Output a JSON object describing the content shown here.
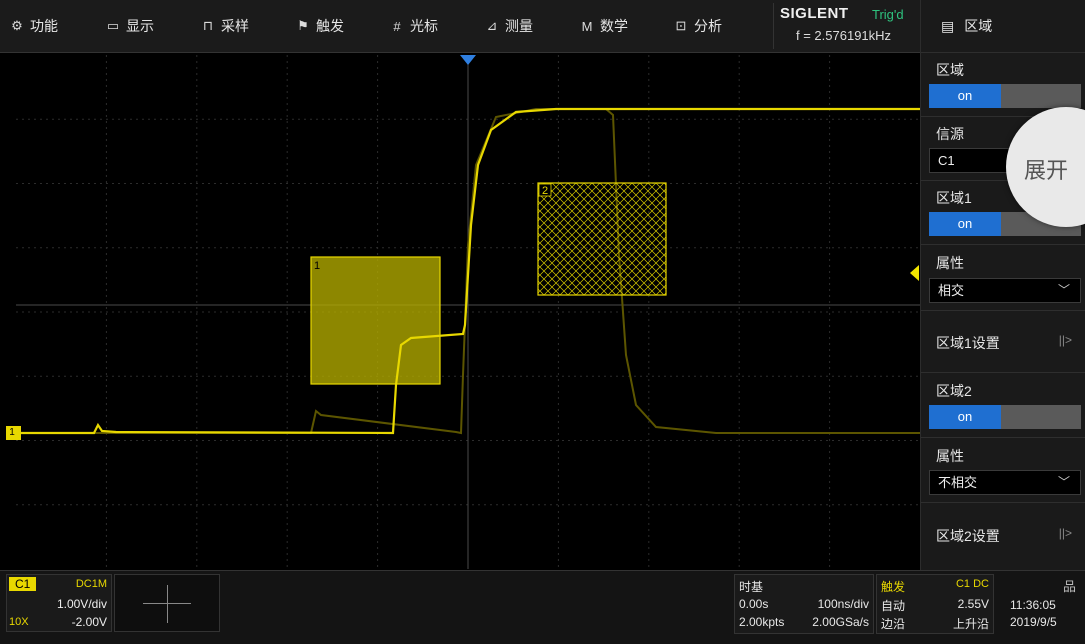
{
  "menu": {
    "items": [
      {
        "label": "功能",
        "icon": "gear-icon",
        "glyph": "⚙"
      },
      {
        "label": "显示",
        "icon": "monitor-icon",
        "glyph": "▭"
      },
      {
        "label": "采样",
        "icon": "acquire-icon",
        "glyph": "⊓"
      },
      {
        "label": "触发",
        "icon": "flag-icon",
        "glyph": "⚑"
      },
      {
        "label": "光标",
        "icon": "cursor-grid-icon",
        "glyph": "#"
      },
      {
        "label": "测量",
        "icon": "measure-icon",
        "glyph": "⊿"
      },
      {
        "label": "数学",
        "icon": "math-icon",
        "glyph": "M"
      },
      {
        "label": "分析",
        "icon": "analysis-icon",
        "glyph": "⊡"
      }
    ]
  },
  "brand": {
    "name": "SIGLENT",
    "status": "Trig'd",
    "frequency": "f = 2.576191kHz"
  },
  "panel": {
    "header": "区域",
    "zone_label": "区域",
    "zone_state": "on",
    "source_label": "信源",
    "source_value": "C1",
    "zone1_label": "区域1",
    "zone1_state": "on",
    "zone1_prop_label": "属性",
    "zone1_prop_value": "相交",
    "zone1_settings": "区域1设置",
    "zone2_label": "区域2",
    "zone2_state": "on",
    "zone2_prop_label": "属性",
    "zone2_prop_value": "不相交",
    "zone2_settings": "区域2设置",
    "expand": "展开",
    "arrow_glyph": "||>"
  },
  "zones": [
    {
      "index": "1"
    },
    {
      "index": "2"
    }
  ],
  "channel": {
    "name": "C1",
    "coupling": "DC1M",
    "scale": "1.00V/div",
    "probe": "10X",
    "offset": "-2.00V",
    "marker": "1"
  },
  "timebase": {
    "title": "时基",
    "delay": "0.00s",
    "scale": "100ns/div",
    "points": "2.00kpts",
    "rate": "2.00GSa/s"
  },
  "trigger": {
    "title": "触发",
    "source": "C1 DC",
    "mode": "自动",
    "level": "2.55V",
    "type": "边沿",
    "slope": "上升沿"
  },
  "clock": {
    "time": "11:36:05",
    "date": "2019/9/5"
  },
  "colors": {
    "trace": "#e8d800",
    "accent": "#1f6fd1",
    "trig_status": "#2ec27e"
  }
}
